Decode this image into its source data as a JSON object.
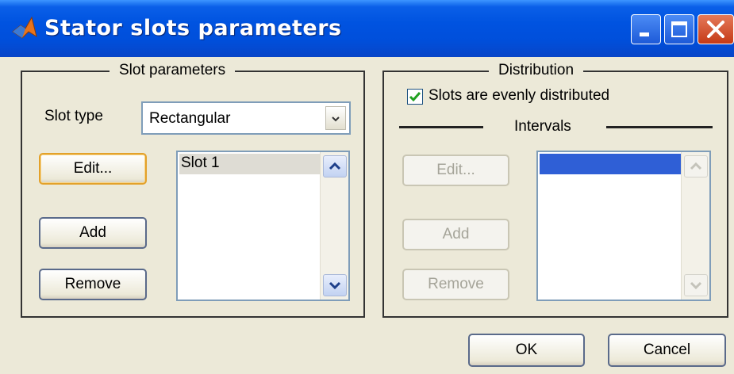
{
  "window": {
    "title": "Stator slots parameters",
    "controls": [
      "minimize-icon",
      "maximize-icon",
      "close-icon"
    ]
  },
  "slot_parameters": {
    "group_title": "Slot parameters",
    "slot_type_label": "Slot type",
    "slot_type_value": "Rectangular",
    "edit_label": "Edit...",
    "add_label": "Add",
    "remove_label": "Remove",
    "slots": [
      "Slot 1"
    ]
  },
  "distribution": {
    "group_title": "Distribution",
    "evenly_distributed_label": "Slots are evenly distributed",
    "evenly_distributed_checked": true,
    "intervals_title": "Intervals",
    "edit_label": "Edit...",
    "add_label": "Add",
    "remove_label": "Remove",
    "intervals": [
      ""
    ]
  },
  "footer": {
    "ok_label": "OK",
    "cancel_label": "Cancel"
  },
  "colors": {
    "title_bar": "#0053e0",
    "default_button_border": "#e3a12a",
    "selection": "#2f5fd6",
    "checkmark": "#21a121"
  }
}
